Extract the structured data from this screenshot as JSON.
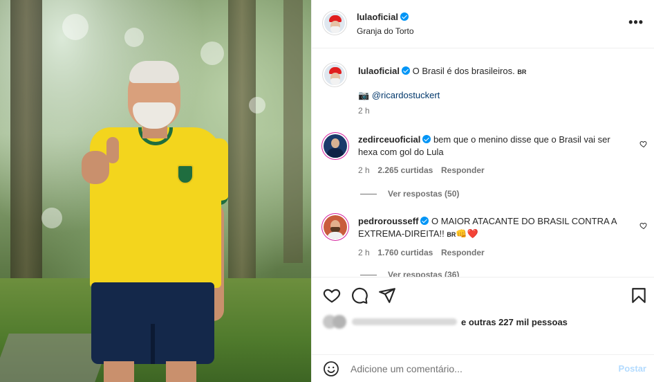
{
  "post": {
    "author": "lulaoficial",
    "location": "Granja do Torto",
    "caption": "O Brasil é dos brasileiros.",
    "caption_tag": "BR",
    "credit_icon": "camera-emoji",
    "credit_link": "@ricardostuckert",
    "time": "2 h"
  },
  "comments": [
    {
      "username": "zedirceuoficial",
      "text": "bem que o menino disse que o Brasil vai ser hexa com gol do Lula",
      "time": "2 h",
      "likes": "2.265 curtidas",
      "reply_label": "Responder",
      "view_replies": "Ver respostas (50)"
    },
    {
      "username": "pedrorousseff",
      "text": "O MAIOR ATACANTE DO BRASIL CONTRA A EXTREMA-DIREITA!!",
      "tag": "BR",
      "emoji": "👊❤️",
      "time": "2 h",
      "likes": "1.760 curtidas",
      "reply_label": "Responder",
      "view_replies": "Ver respostas (36)"
    }
  ],
  "actions": {
    "liked_by_suffix": "e outras 227 mil pessoas"
  },
  "comment_box": {
    "placeholder": "Adicione um comentário...",
    "post_label": "Postar"
  },
  "colors": {
    "verified": "#0095f6",
    "link": "#00376b",
    "post_disabled": "#b3dbff",
    "shirt_yellow": "#f3d51d",
    "shirt_green": "#1f6d3f"
  }
}
